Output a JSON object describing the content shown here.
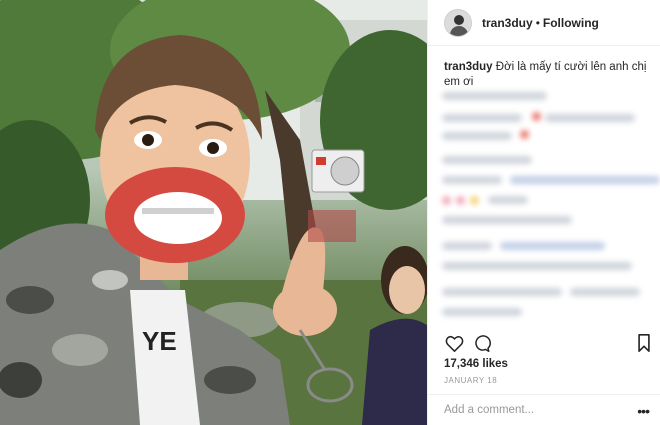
{
  "post": {
    "username": "tran3duy",
    "separator": "•",
    "follow_status": "Following",
    "caption_username": "tran3duy",
    "caption_text": "Đời là mấy tí cười lên anh chị em ơi",
    "likes": "17,346 likes",
    "date": "JANUARY 18",
    "comment_placeholder": "Add a comment...",
    "more_options": "•••"
  },
  "icons": {
    "like": "heart-icon",
    "comment": "comment-icon",
    "save": "bookmark-icon",
    "more": "more-options-icon"
  },
  "colors": {
    "text": "#262626",
    "muted": "#999999",
    "border": "#efefef"
  }
}
